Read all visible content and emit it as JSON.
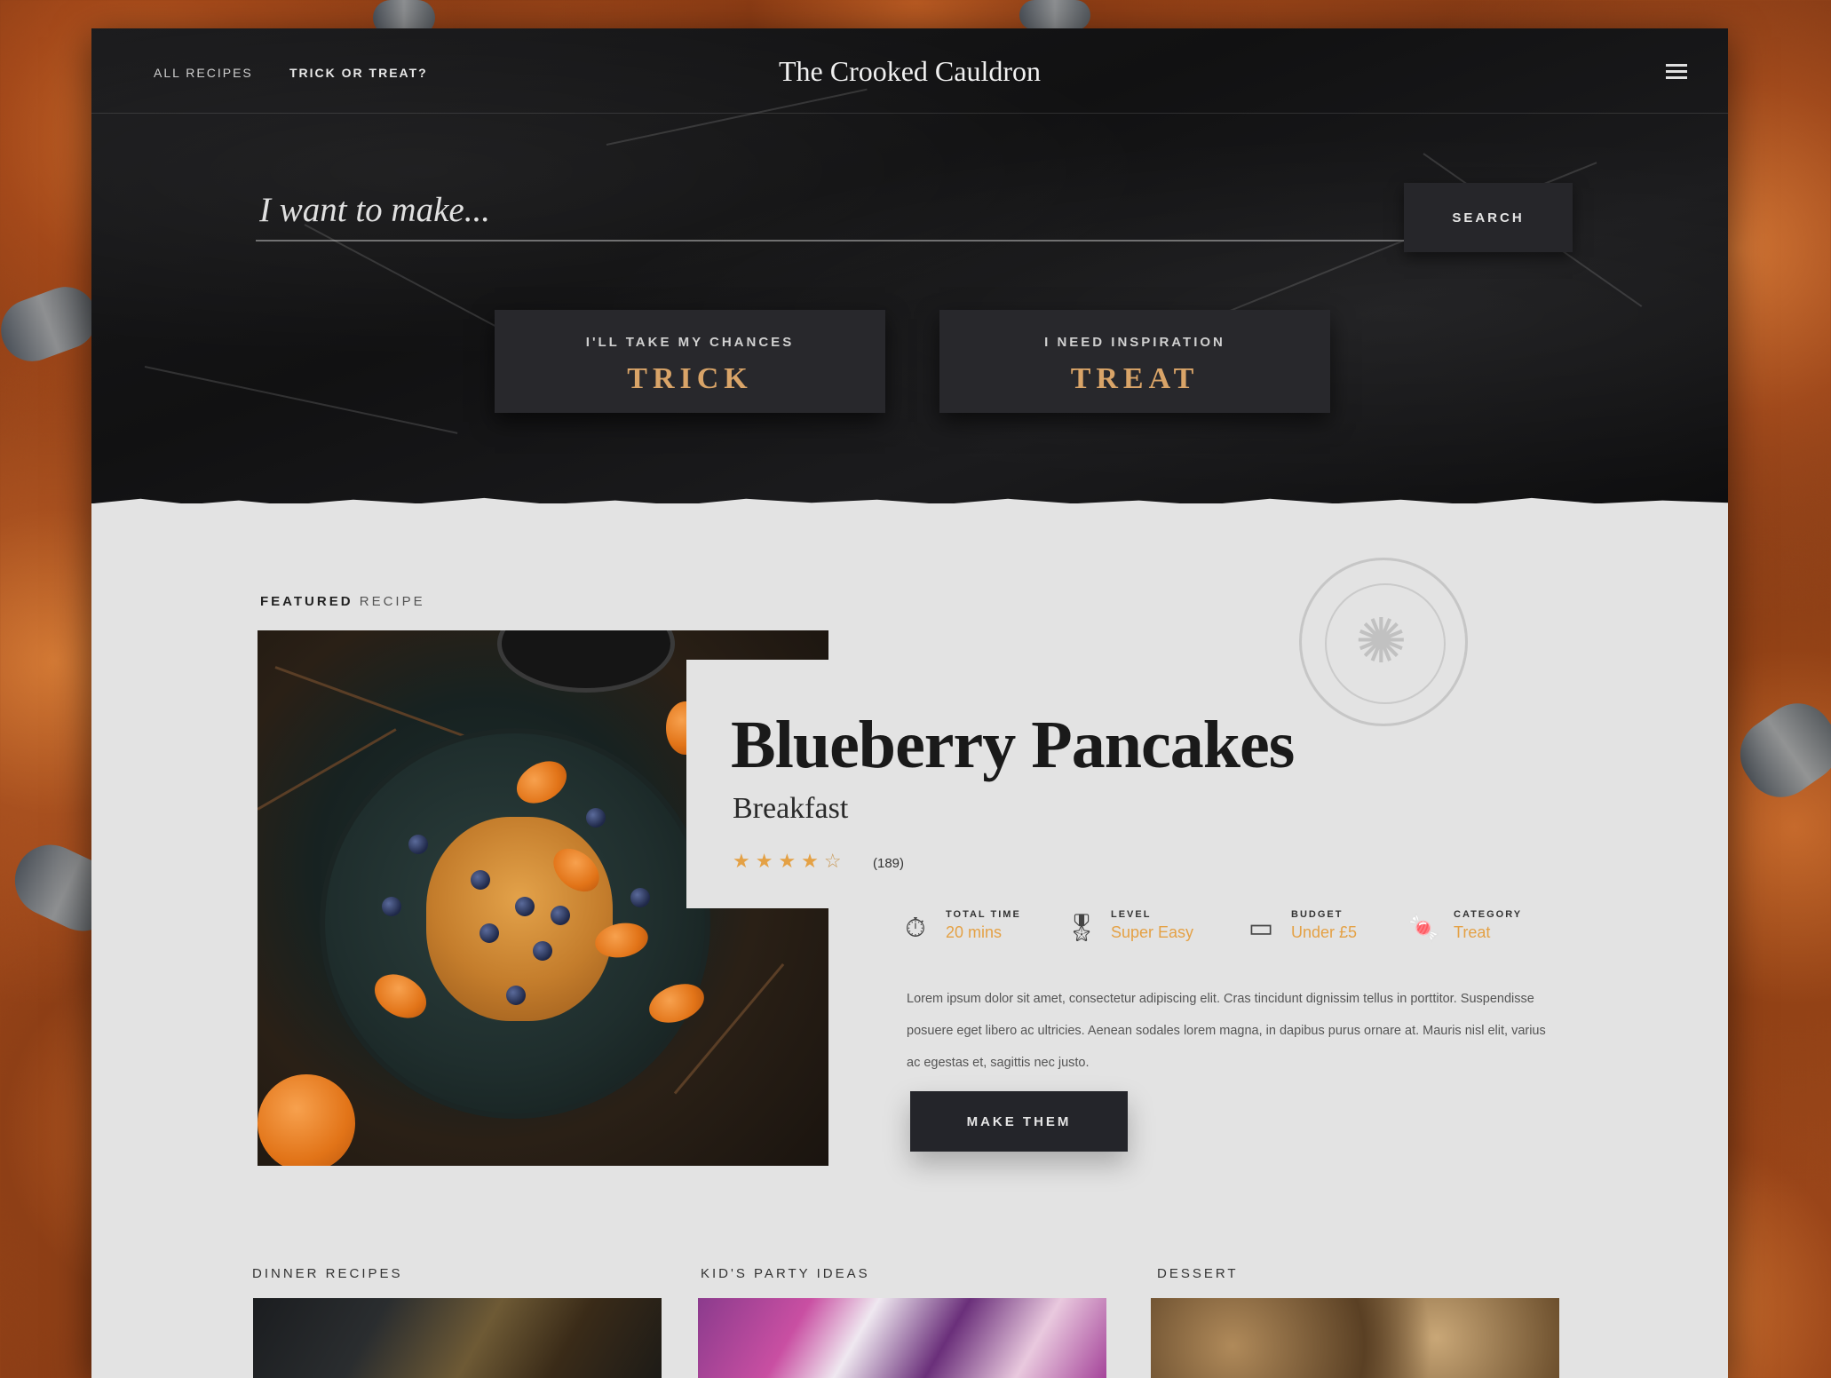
{
  "nav": {
    "all_recipes": "All recipes",
    "trick_or_treat": "Trick or treat?",
    "brand": "The Crooked Cauldron",
    "menu_icon": "hamburger-icon"
  },
  "search": {
    "placeholder": "I want to make...",
    "button_label": "SEARCH"
  },
  "choices": [
    {
      "sub": "I'll take my chances",
      "main": "TRICK"
    },
    {
      "sub": "I need inspiration",
      "main": "TREAT"
    }
  ],
  "featured": {
    "label_bold": "FEATURED",
    "label_rest": " RECIPE",
    "title": "Blueberry Pancakes",
    "category": "Breakfast",
    "stars_filled": "★★★★",
    "stars_empty": "☆",
    "rating": 4,
    "rating_count": "(189)",
    "meta": [
      {
        "icon": "stopwatch-icon",
        "label": "Total time",
        "value": "20 mins"
      },
      {
        "icon": "award-ribbon-icon",
        "label": "Level",
        "value": "Super Easy"
      },
      {
        "icon": "wallet-icon",
        "label": "Budget",
        "value": "Under £5"
      },
      {
        "icon": "candy-icon",
        "label": "Category",
        "value": "Treat"
      }
    ],
    "description": "Lorem ipsum dolor sit amet, consectetur adipiscing elit. Cras tincidunt dignissim tellus in porttitor. Suspendisse posuere eget libero ac ultricies. Aenean sodales lorem magna, in dapibus purus ornare at. Mauris nisl elit, varius ac egestas et, sagittis nec justo.",
    "button_label": "MAKE THEM"
  },
  "categories": [
    {
      "label": "Dinner recipes"
    },
    {
      "label": "Kid's party ideas"
    },
    {
      "label": "Dessert"
    }
  ],
  "colors": {
    "accent": "#e4a145",
    "dark": "#24252a",
    "panel": "#e3e3e3"
  }
}
